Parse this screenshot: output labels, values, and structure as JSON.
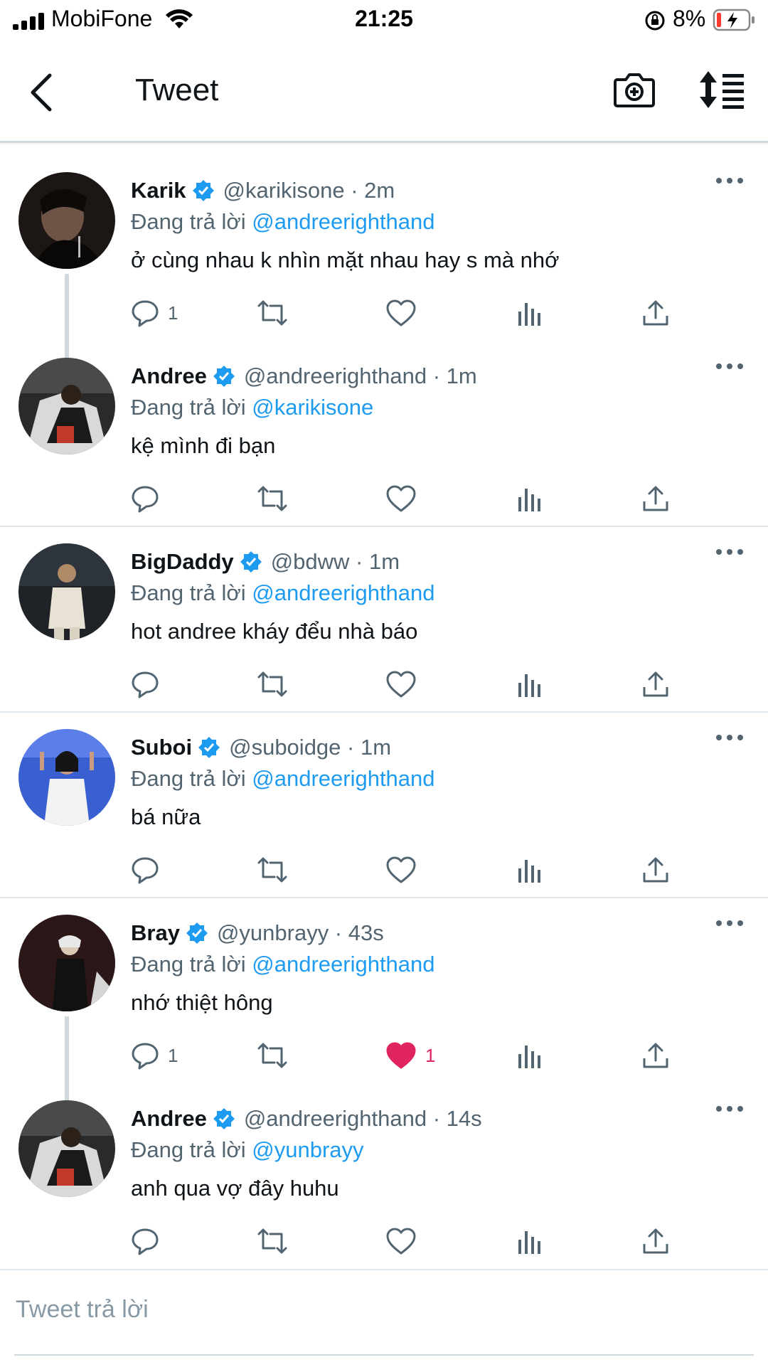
{
  "status_bar": {
    "carrier": "MobiFone",
    "time": "21:25",
    "battery_percent": "8%"
  },
  "header": {
    "title": "Tweet",
    "back_icon": "chevron-left-icon",
    "camera_icon": "camera-add-icon",
    "sort_icon": "sort-list-icon"
  },
  "colors": {
    "accent": "#1d9bf0",
    "like": "#e0245e",
    "secondary_text": "#536471"
  },
  "replying_prefix": "Đang trả lời",
  "tweets": [
    {
      "name": "Karik",
      "handle": "@karikisone · 2m",
      "reply_to": "@andreerighthand",
      "text": "ở cùng nhau k nhìn mặt nhau hay s mà nhớ",
      "reply_count": "1",
      "like_count": "",
      "liked": false
    },
    {
      "name": "Andree",
      "handle": "@andreerighthand · 1m",
      "reply_to": "@karikisone",
      "text": "kệ mình đi bạn",
      "reply_count": "",
      "like_count": "",
      "liked": false
    },
    {
      "name": "BigDaddy",
      "handle": "@bdww · 1m",
      "reply_to": "@andreerighthand",
      "text": "hot andree kháy đểu nhà báo",
      "reply_count": "",
      "like_count": "",
      "liked": false
    },
    {
      "name": "Suboi",
      "handle": "@suboidge · 1m",
      "reply_to": "@andreerighthand",
      "text": "bá nữa",
      "reply_count": "",
      "like_count": "",
      "liked": false
    },
    {
      "name": "Bray",
      "handle": "@yunbrayy · 43s",
      "reply_to": "@andreerighthand",
      "text": "nhớ thiệt hông",
      "reply_count": "1",
      "like_count": "1",
      "liked": true
    },
    {
      "name": "Andree",
      "handle": "@andreerighthand · 14s",
      "reply_to": "@yunbrayy",
      "text": "anh qua vợ đây huhu",
      "reply_count": "",
      "like_count": "",
      "liked": false
    }
  ],
  "reply_box": {
    "placeholder": "Tweet trả lời",
    "value": ""
  }
}
